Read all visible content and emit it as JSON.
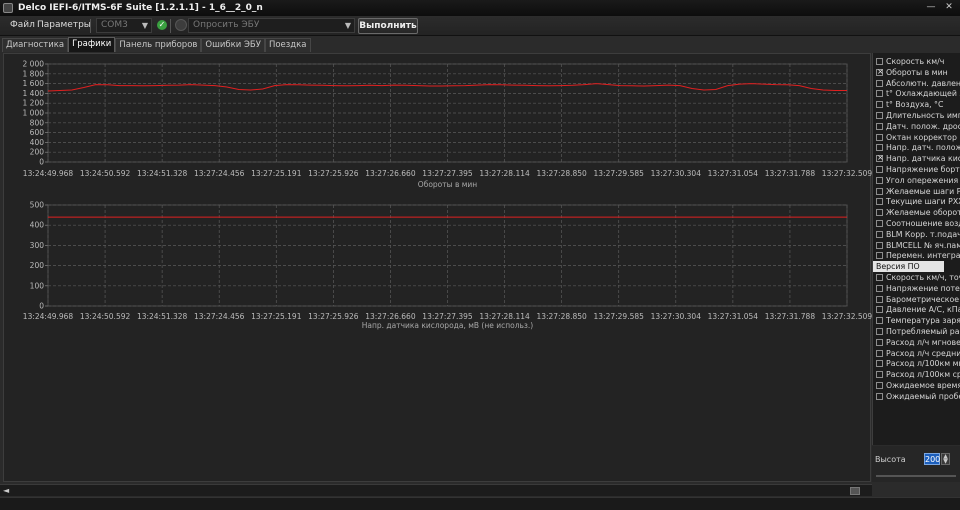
{
  "window": {
    "title": "Delco IEFI-6/ITMS-6F Suite [1.2.1.1] - 1_6__2_0_n",
    "minimize_glyph": "—",
    "close_glyph": "✕"
  },
  "menu": {
    "file": "Файл",
    "params": "Параметры"
  },
  "toolbar": {
    "port": "COM3",
    "query": "Опросить ЭБУ",
    "run": "Выполнить",
    "status_ok_glyph": "✓"
  },
  "tabs": [
    "Диагностика",
    "Графики",
    "Панель приборов",
    "Ошибки ЭБУ",
    "Поездка"
  ],
  "active_tab": "Графики",
  "colors": {
    "series_line": "#e02020",
    "grid": "#5a5a5a",
    "background": "#232323",
    "accent": "#1c5fbd"
  },
  "chart_data": [
    {
      "type": "line",
      "title": "",
      "xlabel": "Обороты в мин",
      "ylabel": "",
      "ylim": [
        0,
        2000
      ],
      "y_ticks": [
        0,
        200,
        400,
        600,
        800,
        1000,
        1200,
        1400,
        1600,
        1800,
        2000
      ],
      "y_tick_labels": [
        "0",
        "200",
        "400",
        "600",
        "800",
        "1 000",
        "1 200",
        "1 400",
        "1 600",
        "1 800",
        "2 000"
      ],
      "x_tick_labels": [
        "13:24:49.968",
        "13:24:50.592",
        "13:24:51.328",
        "13:27:24.456",
        "13:27:25.191",
        "13:27:25.926",
        "13:27:26.660",
        "13:27:27.395",
        "13:27:28.114",
        "13:27:28.850",
        "13:27:29.585",
        "13:27:30.304",
        "13:27:31.054",
        "13:27:31.788",
        "13:27:32.509"
      ],
      "grid": true,
      "series": [
        {
          "values": [
            1450,
            1460,
            1470,
            1520,
            1580,
            1575,
            1560,
            1560,
            1555,
            1560,
            1565,
            1570,
            1580,
            1570,
            1560,
            1530,
            1480,
            1470,
            1490,
            1560,
            1580,
            1575,
            1570,
            1565,
            1560,
            1555,
            1560,
            1565,
            1560,
            1570,
            1565,
            1560,
            1550,
            1550,
            1555,
            1560,
            1570,
            1580,
            1575,
            1570,
            1565,
            1560,
            1555,
            1560,
            1565,
            1580,
            1600,
            1580,
            1560,
            1555,
            1550,
            1560,
            1570,
            1560,
            1500,
            1470,
            1480,
            1560,
            1590,
            1600,
            1590,
            1580,
            1575,
            1560,
            1500,
            1470,
            1460,
            1460
          ]
        }
      ]
    },
    {
      "type": "line",
      "title": "",
      "xlabel": "Напр. датчика кислорода, мВ (не использ.)",
      "ylabel": "",
      "ylim": [
        0,
        500
      ],
      "y_ticks": [
        0,
        100,
        200,
        300,
        400,
        500
      ],
      "y_tick_labels": [
        "0",
        "100",
        "200",
        "300",
        "400",
        "500"
      ],
      "x_tick_labels": [
        "13:24:49.968",
        "13:24:50.592",
        "13:24:51.328",
        "13:27:24.456",
        "13:27:25.191",
        "13:27:25.926",
        "13:27:26.660",
        "13:27:27.395",
        "13:27:28.114",
        "13:27:28.850",
        "13:27:29.585",
        "13:27:30.304",
        "13:27:31.054",
        "13:27:31.788",
        "13:27:32.509"
      ],
      "grid": true,
      "series": [
        {
          "values": [
            440,
            440
          ]
        }
      ]
    }
  ],
  "params": [
    {
      "label": "Скорость км/ч",
      "checked": false
    },
    {
      "label": "Обороты в мин",
      "checked": true
    },
    {
      "label": "Абсолютн. давлен. в",
      "checked": false
    },
    {
      "label": "t° Охлаждающей жи",
      "checked": false
    },
    {
      "label": "t° Воздуха, °C",
      "checked": false
    },
    {
      "label": "Длительность импу",
      "checked": false
    },
    {
      "label": "Датч. полож. дроссе",
      "checked": false
    },
    {
      "label": "Октан корректор",
      "checked": false
    },
    {
      "label": "Напр. датч. полож. д",
      "checked": false
    },
    {
      "label": "Напр. датчика кисл",
      "checked": true
    },
    {
      "label": "Напряжение бортов",
      "checked": false
    },
    {
      "label": "Угол опережения за",
      "checked": false
    },
    {
      "label": "Желаемые шаги РХХ",
      "checked": false
    },
    {
      "label": "Текущие шаги РХХ",
      "checked": false
    },
    {
      "label": "Желаемые оборот",
      "checked": false
    },
    {
      "label": "Соотношение возду",
      "checked": false
    },
    {
      "label": "BLM Корр. т.подачи",
      "checked": false
    },
    {
      "label": "BLMCELL № яч.пам.",
      "checked": false
    },
    {
      "label": "Перемен. интеграто",
      "checked": false
    },
    {
      "label": "Версия ПО",
      "checked": false,
      "selected": true
    },
    {
      "label": "Скорость км/ч, точн",
      "checked": false
    },
    {
      "label": "Напряжение потенц",
      "checked": false
    },
    {
      "label": "Барометрическое д",
      "checked": false
    },
    {
      "label": "Давление А/С, кПа",
      "checked": false
    },
    {
      "label": "Температура заряд",
      "checked": false
    },
    {
      "label": "Потребляемый расх",
      "checked": false
    },
    {
      "label": "Расход л/ч мгновен",
      "checked": false
    },
    {
      "label": "Расход л/ч средний",
      "checked": false
    },
    {
      "label": "Расход л/100км мгн",
      "checked": false
    },
    {
      "label": "Расход л/100км сре",
      "checked": false
    },
    {
      "label": "Ожидаемое время р",
      "checked": false
    },
    {
      "label": "Ожидаемый пробег",
      "checked": false
    }
  ],
  "height_control": {
    "label": "Высота",
    "value": "200",
    "spin_up": "▲",
    "spin_down": "▼"
  },
  "scroll": {
    "left_arrow": "◄"
  }
}
